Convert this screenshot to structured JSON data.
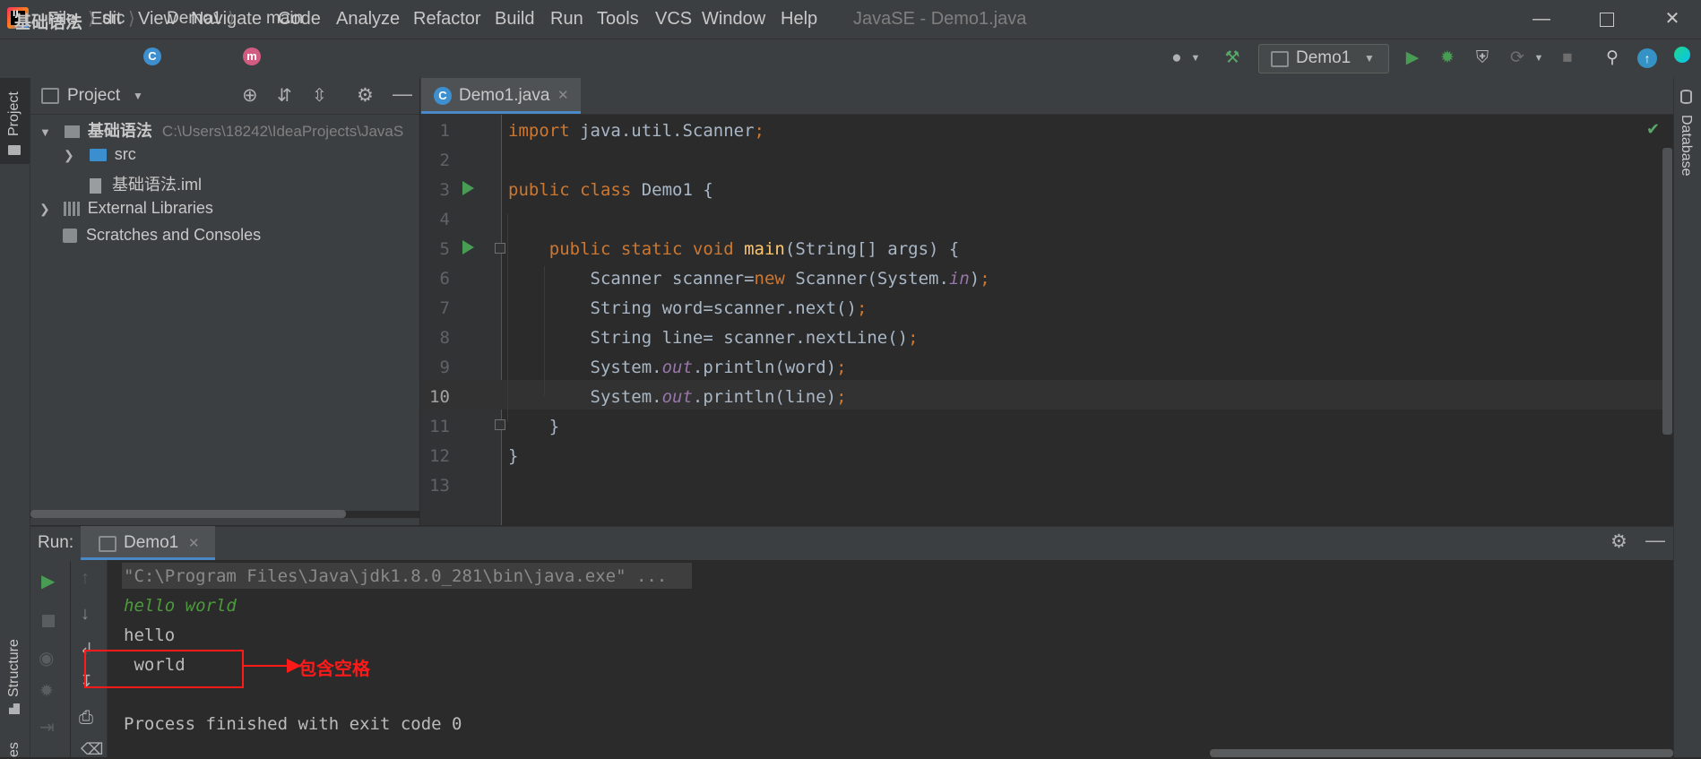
{
  "menubar": {
    "items": [
      "File",
      "Edit",
      "View",
      "Navigate",
      "Code",
      "Analyze",
      "Refactor",
      "Build",
      "Run",
      "Tools",
      "VCS",
      "Window",
      "Help"
    ],
    "window_title": "JavaSE - Demo1.java",
    "logo": "IJ"
  },
  "navbar": {
    "crumbs": [
      "基础语法",
      "src",
      "Demo1",
      "main"
    ],
    "class_badge": "C",
    "method_badge": "m",
    "run_config": "Demo1"
  },
  "left_strip": {
    "project_label": "Project",
    "structure_label": "Structure",
    "bottom_label": "es"
  },
  "right_strip": {
    "database_label": "Database"
  },
  "project_panel": {
    "title": "Project",
    "tree": {
      "root_name": "基础语法",
      "root_path": "C:\\Users\\18242\\IdeaProjects\\JavaS",
      "src": "src",
      "iml": "基础语法.iml",
      "external_libraries": "External Libraries",
      "scratches": "Scratches and Consoles"
    }
  },
  "editor": {
    "tab_label": "Demo1.java",
    "tab_badge": "C",
    "line_numbers": [
      "1",
      "2",
      "3",
      "4",
      "5",
      "6",
      "7",
      "8",
      "9",
      "10",
      "11",
      "12",
      "13"
    ],
    "current_line": 10,
    "code": {
      "l1_kw": "import",
      "l1_rest": " java.util.Scanner",
      "l1_semi": ";",
      "l3_kw": "public class",
      "l3_rest": " Demo1 {",
      "l5_indent": "    ",
      "l5_kw": "public static void",
      "l5_fn": " main",
      "l5_rest": "(String[] args) {",
      "l6_a": "        Scanner scanner=",
      "l6_kw": "new",
      "l6_b": " Scanner(System.",
      "l6_st": "in",
      "l6_c": ")",
      "l6_semi": ";",
      "l7_a": "        String word=scanner.next()",
      "l7_semi": ";",
      "l8_a": "        String line= scanner.nextLine()",
      "l8_semi": ";",
      "l9_a": "        System.",
      "l9_st": "out",
      "l9_b": ".println(word)",
      "l9_semi": ";",
      "l10_a": "        System.",
      "l10_st": "out",
      "l10_b": ".println(line)",
      "l10_semi": ";",
      "l11": "    }",
      "l12": "}"
    }
  },
  "run_panel": {
    "label": "Run:",
    "tab_label": "Demo1",
    "console": {
      "command": "\"C:\\Program Files\\Java\\jdk1.8.0_281\\bin\\java.exe\" ...",
      "input_echo": "hello world",
      "out1": "hello",
      "out2": " world",
      "exit": "Process finished with exit code 0"
    }
  },
  "annotation": {
    "text": "包含空格"
  },
  "colors": {
    "background": "#2b2b2b",
    "panel": "#3c3f41",
    "keyword": "#cc7832",
    "function": "#ffc66d",
    "static_field": "#9876aa",
    "run_green": "#499c54",
    "annotation_red": "#ff1a1a",
    "accent_blue": "#4a88c7"
  }
}
